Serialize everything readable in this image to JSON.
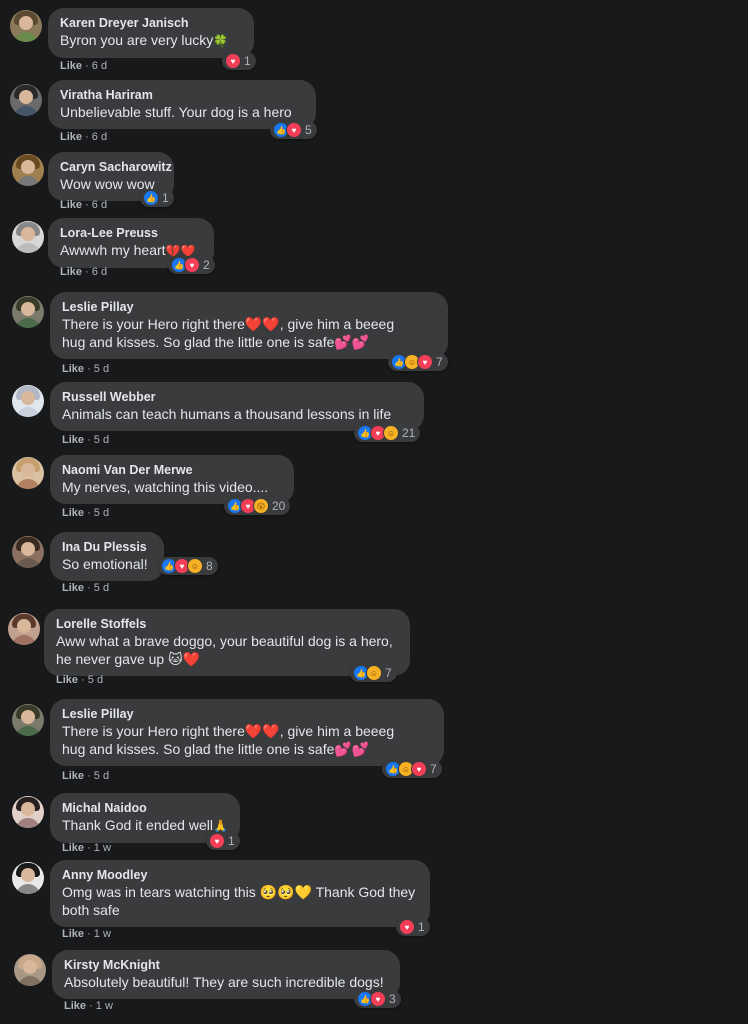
{
  "ui": {
    "like_label": "Like",
    "separator": " · "
  },
  "comments": [
    {
      "name": "Karen Dreyer Janisch",
      "lines": [
        "Byron you are very lucky"
      ],
      "emoji": "🍀",
      "time": "6 d",
      "reactions": [
        "love"
      ],
      "count": "1"
    },
    {
      "name": "Viratha Hariram",
      "lines": [
        "Unbelievable stuff. Your dog is a hero"
      ],
      "emoji": "",
      "time": "6 d",
      "reactions": [
        "like",
        "love"
      ],
      "count": "5"
    },
    {
      "name": "Caryn Sacharowitz",
      "lines": [
        "Wow wow wow"
      ],
      "emoji": "",
      "time": "6 d",
      "reactions": [
        "like"
      ],
      "count": "1"
    },
    {
      "name": "Lora-Lee Preuss",
      "lines": [
        "Awwwh my heart"
      ],
      "emoji": "💔❤️",
      "time": "6 d",
      "reactions": [
        "like",
        "love"
      ],
      "count": "2"
    },
    {
      "name": "Leslie Pillay",
      "lines": [
        "There is your Hero right there❤️❤️, give him a beeeg",
        "hug and kisses. So glad the little one is safe💕💕"
      ],
      "emoji": "",
      "time": "5 d",
      "reactions": [
        "like",
        "care",
        "love"
      ],
      "count": "7"
    },
    {
      "name": "Russell Webber",
      "lines": [
        "Animals can teach humans a thousand lessons in life"
      ],
      "emoji": "",
      "time": "5 d",
      "reactions": [
        "like",
        "love",
        "care"
      ],
      "count": "21"
    },
    {
      "name": "Naomi Van Der Merwe",
      "lines": [
        "My nerves, watching this video...."
      ],
      "emoji": "",
      "time": "5 d",
      "reactions": [
        "like",
        "love",
        "wow"
      ],
      "count": "20"
    },
    {
      "name": "Ina Du Plessis",
      "lines": [
        "So emotional!"
      ],
      "emoji": "",
      "time": "5 d",
      "reactions": [
        "like",
        "love",
        "care"
      ],
      "count": "8"
    },
    {
      "name": "Lorelle Stoffels",
      "lines": [
        "Aww what a brave doggo, your beautiful dog is a hero,",
        "he never gave up 🐱❤️"
      ],
      "emoji": "",
      "time": "5 d",
      "reactions": [
        "like",
        "care"
      ],
      "count": "7"
    },
    {
      "name": "Leslie Pillay",
      "lines": [
        "There is your Hero right there❤️❤️, give him a beeeg",
        "hug and kisses. So glad the little one is safe💕💕"
      ],
      "emoji": "",
      "time": "5 d",
      "reactions": [
        "like",
        "care",
        "love"
      ],
      "count": "7"
    },
    {
      "name": "Michal Naidoo",
      "lines": [
        "Thank God it ended well"
      ],
      "emoji": "🙏",
      "time": "1 w",
      "reactions": [
        "love"
      ],
      "count": "1"
    },
    {
      "name": "Anny Moodley",
      "lines": [
        "Omg was in tears watching this 🥺🥺💛 Thank God they",
        "both safe"
      ],
      "emoji": "",
      "time": "1 w",
      "reactions": [
        "love"
      ],
      "count": "1"
    },
    {
      "name": "Kirsty McKnight",
      "lines": [
        "Absolutely beautiful! They are such incredible dogs!"
      ],
      "emoji": "",
      "time": "1 w",
      "reactions": [
        "like",
        "love"
      ],
      "count": "3"
    }
  ]
}
